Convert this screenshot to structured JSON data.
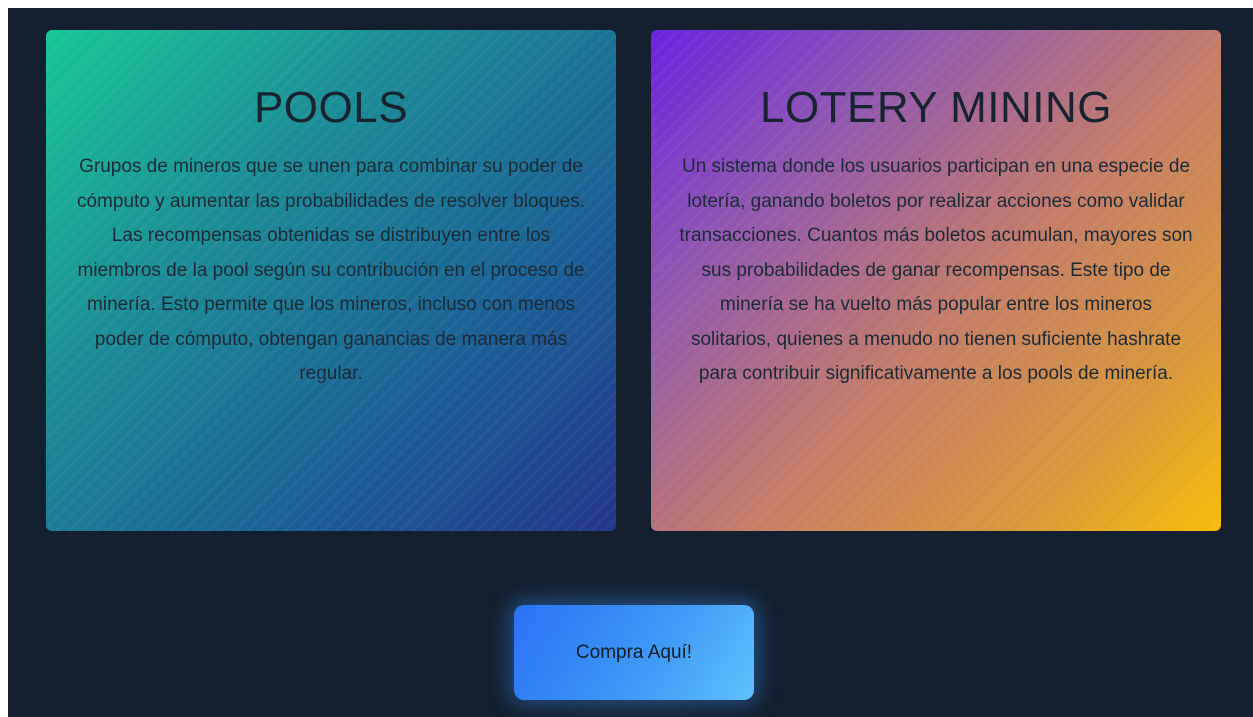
{
  "cards": [
    {
      "title": "POOLS",
      "description": "Grupos de mineros que se unen para combinar su poder de cómputo y aumentar las probabilidades de resolver bloques. Las recompensas obtenidas se distribuyen entre los miembros de la pool según su contribución en el proceso de minería. Esto permite que los mineros, incluso con menos poder de cómputo, obtengan ganancias de manera más regular."
    },
    {
      "title": "LOTERY MINING",
      "description": "Un sistema donde los usuarios participan en una especie de lotería, ganando boletos por realizar acciones como validar transacciones. Cuantos más boletos acumulan, mayores son sus probabilidades de ganar recompensas. Este tipo de minería se ha vuelto más popular entre los mineros solitarios, quienes a menudo no tienen suficiente hashrate para contribuir significativamente a los pools de minería."
    }
  ],
  "cta": {
    "label": "Compra Aquí!"
  },
  "colors": {
    "background": "#142030",
    "pools_gradient_start": "#17c795",
    "pools_gradient_end": "#23368b",
    "lottery_gradient_start": "#6a22df",
    "lottery_gradient_end": "#f5bd08",
    "button": "#3d98f7"
  }
}
